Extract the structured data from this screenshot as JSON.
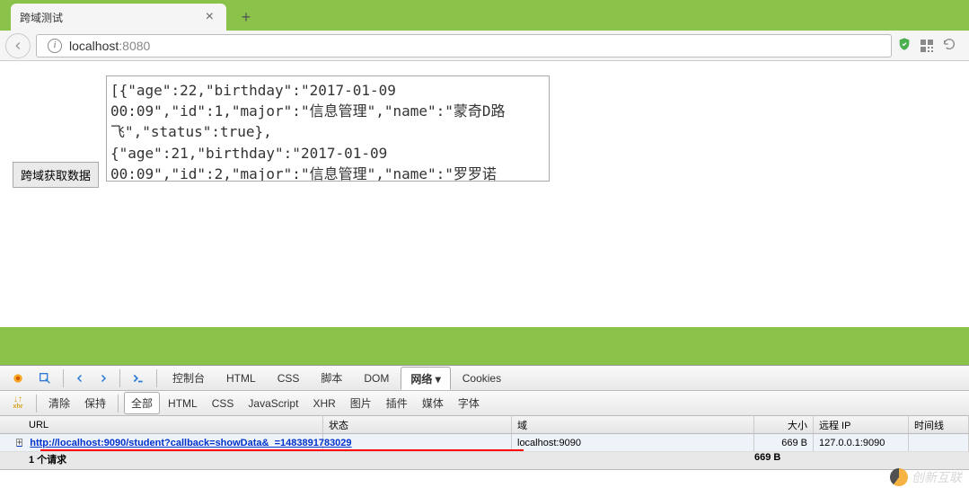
{
  "tab": {
    "title": "跨域测试",
    "close": "×"
  },
  "tab_add": "+",
  "info_glyph": "i",
  "url": {
    "host": "localhost",
    "port": ":8080"
  },
  "page": {
    "button": "跨域获取数据",
    "textarea_value": "[{\"age\":22,\"birthday\":\"2017-01-09 00:09\",\"id\":1,\"major\":\"信息管理\",\"name\":\"蒙奇D路飞\",\"status\":true},\n{\"age\":21,\"birthday\":\"2017-01-09 00:09\",\"id\":2,\"major\":\"信息管理\",\"name\":\"罗罗诺"
  },
  "devtools": {
    "tabs": [
      "控制台",
      "HTML",
      "CSS",
      "脚本",
      "DOM",
      "网络 ▾",
      "Cookies"
    ],
    "active_tab_index": 5,
    "xhr_label": "xhr",
    "subtabs": [
      "清除",
      "保持"
    ],
    "filters": [
      "全部",
      "HTML",
      "CSS",
      "JavaScript",
      "XHR",
      "图片",
      "插件",
      "媒体",
      "字体"
    ],
    "active_filter_index": 0,
    "columns": {
      "url": "URL",
      "status": "状态",
      "domain": "域",
      "size": "大小",
      "ip": "远程 IP",
      "timeline": "时间线"
    },
    "row": {
      "expand": "+",
      "url": "http://localhost:9090/student?callback=showData&_=1483891783029",
      "status": "",
      "domain": "localhost:9090",
      "size": "669 B",
      "ip": "127.0.0.1:9090",
      "timeline": ""
    },
    "summary": {
      "text": "1 个请求",
      "size": "669 B"
    }
  },
  "watermark": "创新互联"
}
